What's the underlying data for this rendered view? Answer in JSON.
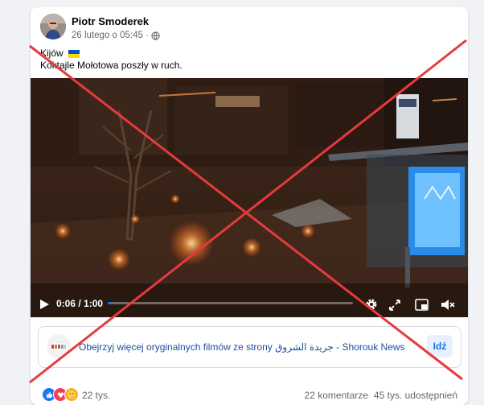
{
  "post": {
    "author": "Piotr Smoderek",
    "timestamp": "26 lutego o 05:45 ·",
    "text_line1": "Kijów",
    "text_line2": "Koktajle Mołotowa poszły w ruch.",
    "flag_icon": "ukraine-flag-icon"
  },
  "video": {
    "time_display": "0:06 / 1:00",
    "progress": 0.02,
    "progress_color": "#1877f2",
    "icons": [
      "play-icon",
      "gear-icon",
      "fullscreen-icon",
      "miniplayer-icon",
      "mute-icon"
    ]
  },
  "page_promo": {
    "text": "Obejrzyj więcej oryginalnych filmów ze strony جريدة الشروق - Shorouk News",
    "button_label": "Idź"
  },
  "footer": {
    "reactions_count": "22 tys.",
    "reaction_icons": [
      "like-icon",
      "love-icon",
      "care-icon"
    ],
    "comments": "22 komentarze",
    "shares": "45 tys. udostępnień"
  },
  "overlay": {
    "cross_color": "#e63a3e"
  }
}
